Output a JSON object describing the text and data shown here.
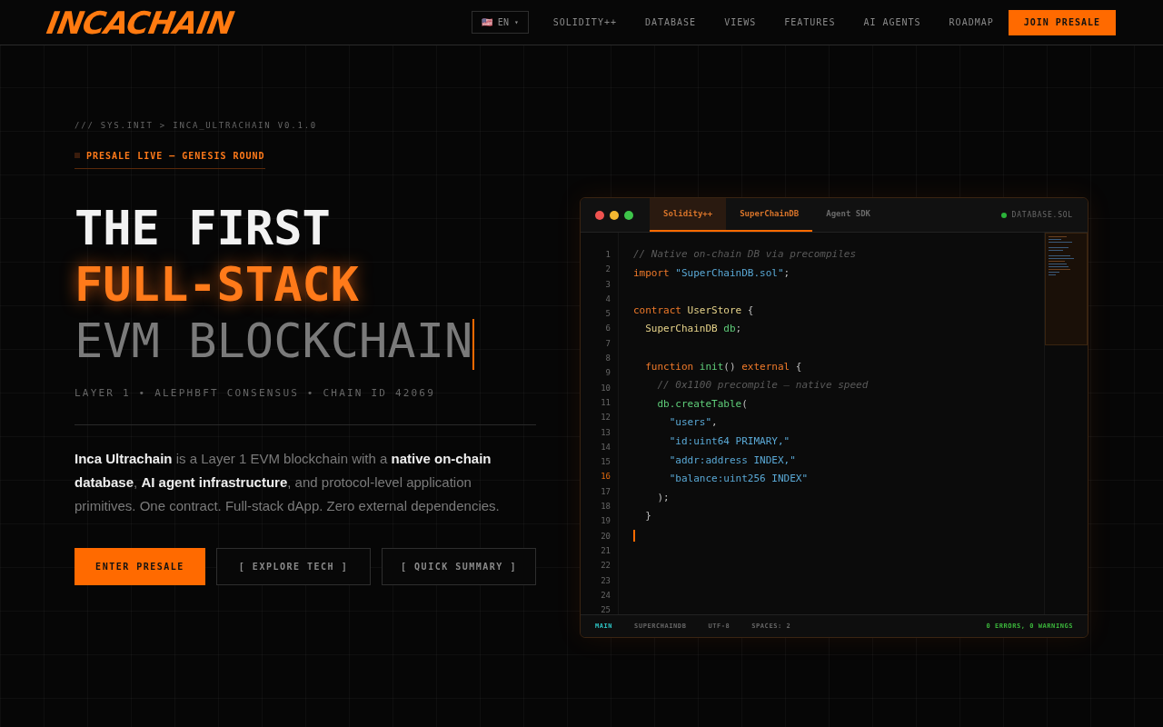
{
  "header": {
    "logo": "INCACHAIN",
    "language": {
      "flag": "🇺🇸",
      "code": "EN",
      "caret": "▾"
    },
    "nav": [
      {
        "label": "SOLIDITY++"
      },
      {
        "label": "DATABASE"
      },
      {
        "label": "VIEWS"
      },
      {
        "label": "FEATURES"
      },
      {
        "label": "AI AGENTS"
      },
      {
        "label": "ROADMAP"
      }
    ],
    "cta": "JOIN PRESALE"
  },
  "hero": {
    "breadcrumb": "/// SYS.INIT > INCA_ULTRACHAIN V0.1.0",
    "badge": "PRESALE LIVE — GENESIS ROUND",
    "title_lines": [
      {
        "text": "THE FIRST",
        "kind": "plain"
      },
      {
        "text": "FULL-STACK",
        "kind": "accent"
      },
      {
        "text": "EVM BLOCKCHAIN",
        "kind": "muted"
      }
    ],
    "specs": "LAYER 1 • ALEPHBFT CONSENSUS • CHAIN ID 42069",
    "description": "**Inca Ultrachain** is a Layer 1 EVM blockchain with a **native on-chain database**, **AI agent infrastructure**, and protocol-level application primitives. One contract. Full-stack dApp. Zero external dependencies.",
    "buttons": [
      {
        "label": "ENTER PRESALE",
        "kind": "primary"
      },
      {
        "label": "[ EXPLORE TECH ]",
        "kind": "outline"
      },
      {
        "label": "[ QUICK SUMMARY ]",
        "kind": "outline"
      }
    ]
  },
  "editor": {
    "tabs": [
      {
        "label": "Solidity++",
        "selected": true,
        "open": true
      },
      {
        "label": "SuperChainDB",
        "selected": false,
        "open": true
      },
      {
        "label": "Agent SDK",
        "selected": false,
        "open": false
      }
    ],
    "file": "DATABASE.SOL",
    "line_numbers": [
      {
        "number": "1",
        "active": false
      },
      {
        "number": "2",
        "active": false
      },
      {
        "number": "3",
        "active": false
      },
      {
        "number": "4",
        "active": false
      },
      {
        "number": "5",
        "active": false
      },
      {
        "number": "6",
        "active": false
      },
      {
        "number": "7",
        "active": false
      },
      {
        "number": "8",
        "active": false
      },
      {
        "number": "9",
        "active": false
      },
      {
        "number": "10",
        "active": false
      },
      {
        "number": "11",
        "active": false
      },
      {
        "number": "12",
        "active": false
      },
      {
        "number": "13",
        "active": false
      },
      {
        "number": "14",
        "active": false
      },
      {
        "number": "15",
        "active": false
      },
      {
        "number": "16",
        "active": true
      },
      {
        "number": "17",
        "active": false
      },
      {
        "number": "18",
        "active": false
      },
      {
        "number": "19",
        "active": false
      },
      {
        "number": "20",
        "active": false
      },
      {
        "number": "21",
        "active": false
      },
      {
        "number": "22",
        "active": false
      },
      {
        "number": "23",
        "active": false
      },
      {
        "number": "24",
        "active": false
      },
      {
        "number": "25",
        "active": false
      }
    ],
    "code": [
      {
        "kind": "code",
        "tokens": [
          {
            "text": "// Native on-chain DB via precompiles",
            "kind": "comment"
          }
        ]
      },
      {
        "kind": "code",
        "tokens": [
          {
            "text": "import",
            "kind": "keyword"
          },
          {
            "text": " \"SuperChainDB.sol\"",
            "kind": "string"
          },
          {
            "text": ";",
            "kind": "plain"
          }
        ]
      },
      {
        "kind": "blank"
      },
      {
        "kind": "code",
        "tokens": [
          {
            "text": "contract",
            "kind": "keyword"
          },
          {
            "text": " UserStore",
            "kind": "type"
          },
          {
            "text": " {",
            "kind": "plain"
          }
        ]
      },
      {
        "kind": "code",
        "tokens": [
          {
            "text": "  SuperChainDB",
            "kind": "type"
          },
          {
            "text": " db",
            "kind": "ident"
          },
          {
            "text": ";",
            "kind": "plain"
          }
        ]
      },
      {
        "kind": "blank"
      },
      {
        "kind": "code",
        "tokens": [
          {
            "text": "  function",
            "kind": "keyword"
          },
          {
            "text": " init",
            "kind": "ident"
          },
          {
            "text": "() ",
            "kind": "plain"
          },
          {
            "text": "external",
            "kind": "keyword"
          },
          {
            "text": " {",
            "kind": "plain"
          }
        ]
      },
      {
        "kind": "code",
        "tokens": [
          {
            "text": "    // 0x1100 precompile — native speed",
            "kind": "comment"
          }
        ]
      },
      {
        "kind": "code",
        "tokens": [
          {
            "text": "    db.createTable",
            "kind": "ident"
          },
          {
            "text": "(",
            "kind": "plain"
          }
        ]
      },
      {
        "kind": "code",
        "tokens": [
          {
            "text": "      \"users\"",
            "kind": "string"
          },
          {
            "text": ",",
            "kind": "plain"
          }
        ]
      },
      {
        "kind": "code",
        "tokens": [
          {
            "text": "      \"id:uint64 PRIMARY,\"",
            "kind": "string"
          }
        ]
      },
      {
        "kind": "code",
        "tokens": [
          {
            "text": "      \"addr:address INDEX,\"",
            "kind": "string"
          }
        ]
      },
      {
        "kind": "code",
        "tokens": [
          {
            "text": "      \"balance:uint256 INDEX\"",
            "kind": "string"
          }
        ]
      },
      {
        "kind": "code",
        "tokens": [
          {
            "text": "    );",
            "kind": "plain"
          }
        ]
      },
      {
        "kind": "code",
        "tokens": [
          {
            "text": "  }",
            "kind": "plain"
          }
        ]
      },
      {
        "kind": "cursor"
      }
    ],
    "status": [
      {
        "label": "MAIN",
        "selected": true
      },
      {
        "label": "SUPERCHAINDB",
        "selected": false
      },
      {
        "label": "UTF-8",
        "selected": false
      },
      {
        "label": "SPACES: 2",
        "selected": false
      }
    ],
    "diagnostics": "0 ERRORS, 0 WARNINGS"
  }
}
